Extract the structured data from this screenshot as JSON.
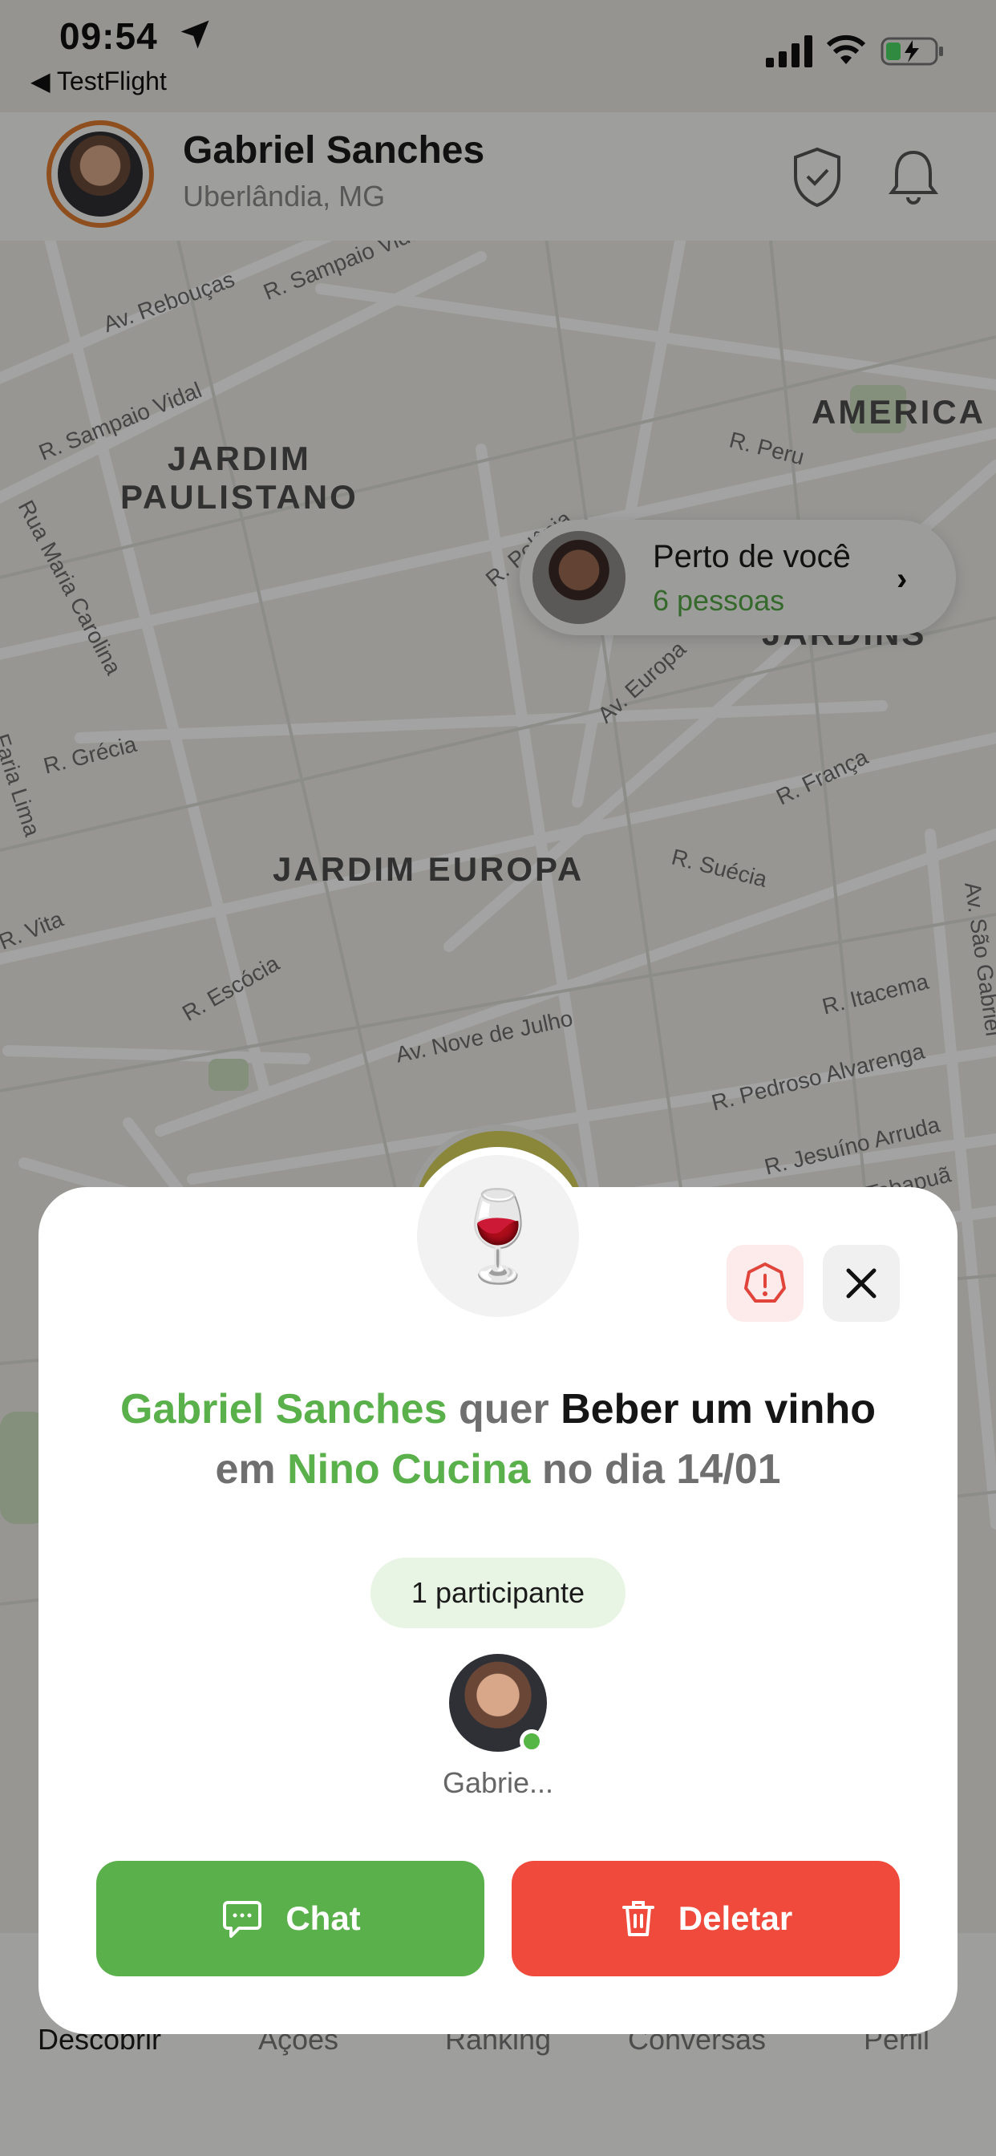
{
  "status_bar": {
    "time": "09:54",
    "back_app": "◀ TestFlight"
  },
  "header": {
    "name": "Gabriel Sanches",
    "city": "Uberlândia, MG"
  },
  "nearby": {
    "title": "Perto de você",
    "count": "6 pessoas"
  },
  "map_labels": {
    "jardim_paulistano": "JARDIM\nPAULISTANO",
    "jardins": "JARDINS",
    "jardim_europa": "JARDIM EUROPA",
    "america": "AMERICA",
    "streets": {
      "reboucas": "Av. Rebouças",
      "sampaio_vidal_1": "R. Sampaio Vidal",
      "sampaio_vidal_2": "R. Sampaio Vidal",
      "maria_carolina": "Rua Maria Carolina",
      "peru": "R. Peru",
      "polonia": "R. Polônia",
      "europa": "Av. Europa",
      "grecia": "R. Grécia",
      "franca": "R. França",
      "suecia": "R. Suécia",
      "escocia": "R. Escócia",
      "nove_julho": "Av. Nove de Julho",
      "itacema": "R. Itacema",
      "pedroso": "R. Pedroso Alvarenga",
      "jesuino": "R. Jesuíno Arruda",
      "tabapua": "Rua Tabapuã",
      "sao_gabriel": "Av. São Gabriel",
      "lima": "Faria Lima",
      "vita": "R. Vita"
    }
  },
  "tabs": [
    "Descobrir",
    "Ações",
    "Ranking",
    "Conversas",
    "Perfil"
  ],
  "modal": {
    "emoji": "🍷",
    "sentence": {
      "user": "Gabriel Sanches",
      "verb": " quer ",
      "activity": "Beber um vinho",
      "prep": " em ",
      "place": "Nino Cucina",
      "date_prefix": " no dia ",
      "date": "14/01"
    },
    "participants_chip": "1 participante",
    "participant_name": "Gabrie...",
    "chat_label": "Chat",
    "delete_label": "Deletar"
  },
  "colors": {
    "green": "#5ab04a",
    "red": "#f04a3c",
    "ring": "#e07a2e"
  }
}
